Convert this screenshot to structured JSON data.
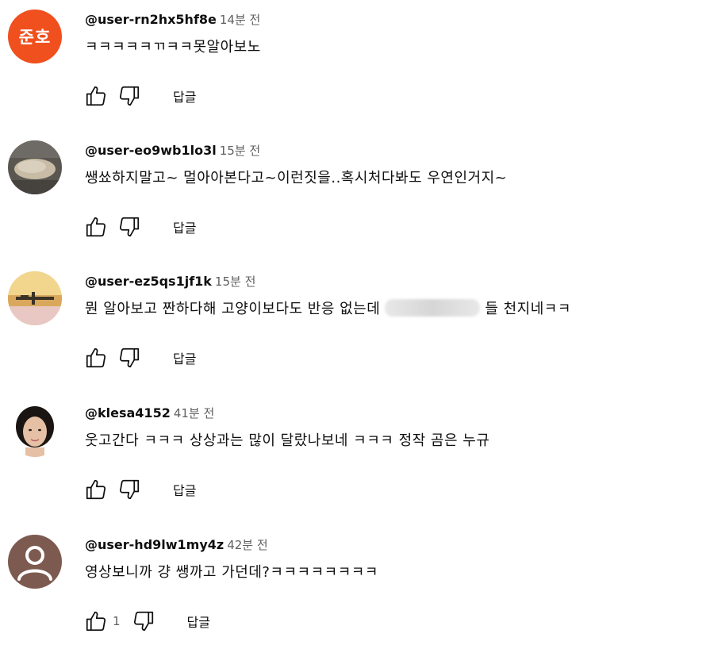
{
  "comments": [
    {
      "avatar_text": "준호",
      "handle": "@user-rn2hx5hf8e",
      "time": "14분 전",
      "text": "ㅋㅋㅋㅋㅋㄲㅋㅋ못알아보노",
      "reply": "답글"
    },
    {
      "handle": "@user-eo9wb1lo3l",
      "time": "15분 전",
      "text": "쌩쑈하지말고~ 멀아아본다고~이런짓을..혹시처다봐도 우연인거지~",
      "reply": "답글"
    },
    {
      "handle": "@user-ez5qs1jf1k",
      "time": "15분 전",
      "text_before": "뭔 알아보고 짠하다해 고양이보다도 반응 없는데",
      "text_after": "들 천지네ㅋㅋ",
      "reply": "답글"
    },
    {
      "handle": "@klesa4152",
      "time": "41분 전",
      "text": "웃고간다 ㅋㅋㅋ 상상과는 많이 달랐나보네 ㅋㅋㅋ 정작 곰은 누규",
      "reply": "답글"
    },
    {
      "handle": "@user-hd9lw1my4z",
      "time": "42분 전",
      "text": "영상보니까 걍 쌩까고 가던데?ㅋㅋㅋㅋㅋㅋㅋㅋ",
      "like_count": "1",
      "reply": "답글"
    }
  ],
  "icons": {
    "like": "thumbs-up-icon",
    "dislike": "thumbs-down-icon"
  },
  "colors": {
    "avatar_orange": "#f0501e",
    "meta_gray": "#606060"
  }
}
